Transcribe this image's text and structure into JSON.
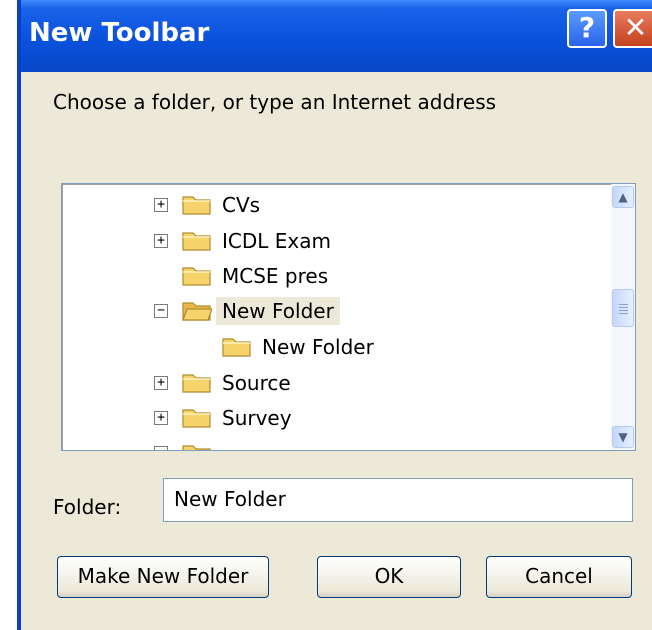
{
  "dialog": {
    "title": "New Toolbar",
    "help_label": "?",
    "close_label": "✕",
    "prompt": "Choose a folder, or type an Internet address"
  },
  "tree": {
    "items": [
      {
        "label": "CVs",
        "expander": "+",
        "selected": false
      },
      {
        "label": "ICDL Exam",
        "expander": "+",
        "selected": false
      },
      {
        "label": "MCSE pres",
        "expander": "",
        "selected": false
      },
      {
        "label": "New Folder",
        "expander": "−",
        "selected": true
      },
      {
        "label": "New Folder",
        "expander": "",
        "selected": false
      },
      {
        "label": "Source",
        "expander": "+",
        "selected": false
      },
      {
        "label": "Survey",
        "expander": "+",
        "selected": false
      }
    ],
    "scroll_up": "▲",
    "scroll_down": "▼"
  },
  "folder_field": {
    "label": "Folder:",
    "value": "New Folder"
  },
  "buttons": {
    "make_new_folder": "Make New Folder",
    "ok": "OK",
    "cancel": "Cancel"
  },
  "colors": {
    "titlebar": "#0a52dc",
    "dialog_bg": "#ece9d8",
    "folder_yellow": "#f7d36b"
  }
}
